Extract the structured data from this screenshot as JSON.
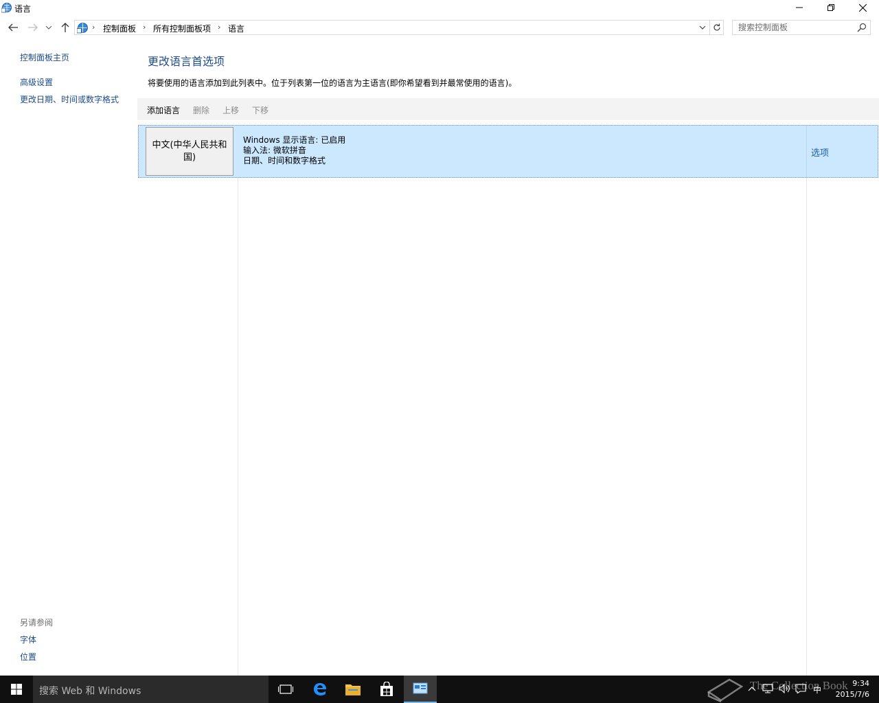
{
  "window": {
    "title": "语言",
    "icons": {
      "app": "globe-clock-icon",
      "minimize": "minimize-icon",
      "maximize": "restore-icon",
      "close": "close-icon"
    }
  },
  "nav": {
    "back": "back-arrow-icon",
    "forward": "forward-arrow-icon",
    "recent": "chevron-down-icon",
    "up": "up-arrow-icon",
    "breadcrumbs": [
      "控制面板",
      "所有控制面板项",
      "语言"
    ],
    "search_placeholder": "搜索控制面板"
  },
  "left_pane": {
    "home": "控制面板主页",
    "links": [
      "高级设置",
      "更改日期、时间或数字格式"
    ],
    "see_also_title": "另请参阅",
    "see_also": [
      "字体",
      "位置"
    ]
  },
  "main": {
    "heading": "更改语言首选项",
    "description": "将要使用的语言添加到此列表中。位于列表第一位的语言为主语言(即你希望看到并最常使用的语言)。",
    "toolbar": {
      "add": "添加语言",
      "remove": "删除",
      "move_up": "上移",
      "move_down": "下移"
    },
    "languages": [
      {
        "name": "中文(中华人民共和国)",
        "line1": "Windows 显示语言: 已启用",
        "line2": "输入法: 微软拼音",
        "line3": "日期、时间和数字格式",
        "options": "选项"
      }
    ]
  },
  "taskbar": {
    "search_placeholder": "搜索 Web 和 Windows",
    "time": "9:34",
    "date": "2015/7/6",
    "ime": "中",
    "watermark": "The Collection Book"
  },
  "colors": {
    "accent": "#1e4e8c",
    "selection": "#cce8ff",
    "link": "#1a5fa8",
    "taskbar": "#101010"
  }
}
